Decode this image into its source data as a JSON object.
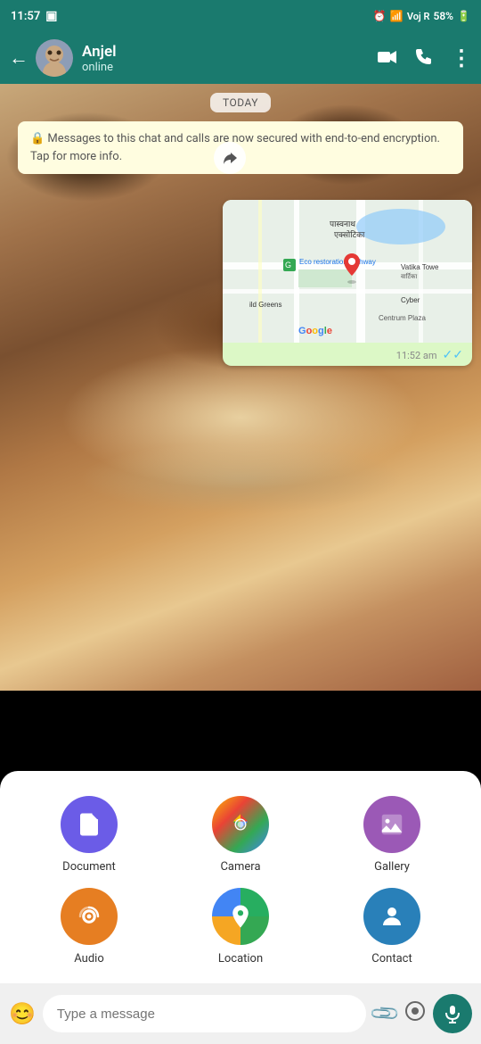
{
  "statusBar": {
    "time": "11:57",
    "battery": "58%",
    "signal": "Voj R"
  },
  "header": {
    "backLabel": "←",
    "contactName": "Anjel",
    "contactStatus": "online",
    "videoIcon": "📹",
    "callIcon": "📞",
    "moreIcon": "⋮"
  },
  "chat": {
    "dateBubble": "TODAY",
    "encryptionNotice": "🔒 Messages to this chat and calls are now secured with end-to-end encryption. Tap for more info.",
    "mapTime": "11:52 am",
    "mapDoubleTick": "✓✓",
    "mapLabel": "Eco restoration pathway"
  },
  "attachMenu": {
    "items": [
      {
        "id": "document",
        "label": "Document",
        "icon": "📄",
        "color": "#6b5ce7"
      },
      {
        "id": "camera",
        "label": "Camera",
        "icon": "📷",
        "color": "#f5a623"
      },
      {
        "id": "gallery",
        "label": "Gallery",
        "icon": "🖼",
        "color": "#9b59b6"
      },
      {
        "id": "audio",
        "label": "Audio",
        "icon": "🎧",
        "color": "#e67e22"
      },
      {
        "id": "location",
        "label": "Location",
        "icon": "📍",
        "color": "#27ae60"
      },
      {
        "id": "contact",
        "label": "Contact",
        "icon": "👤",
        "color": "#2980b9"
      }
    ]
  },
  "inputBar": {
    "placeholder": "Type a message",
    "emojiIcon": "😊",
    "attachIcon": "📎",
    "cameraIcon": "⊙",
    "micIcon": "🎤"
  }
}
